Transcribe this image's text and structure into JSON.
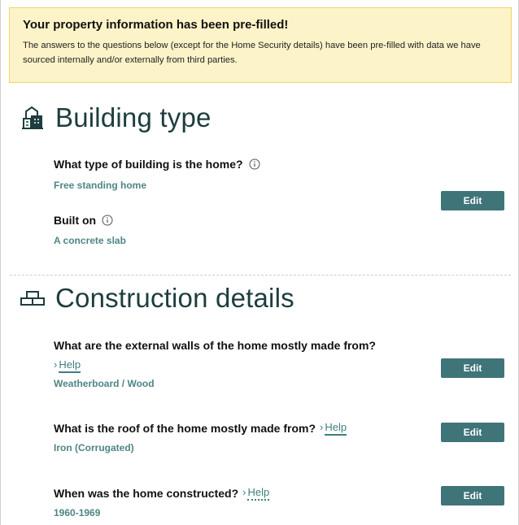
{
  "banner": {
    "title": "Your property information has been pre-filled!",
    "text": "The answers to the questions below (except for the Home Security details) have been pre-filled with data we have sourced internally and/or externally from third parties."
  },
  "building_type": {
    "title": "Building type",
    "icon": "building-icon",
    "questions": [
      {
        "label": "What type of building is the home?",
        "answer": "Free standing home",
        "has_info": true
      },
      {
        "label": "Built on",
        "answer": "A concrete slab",
        "has_info": true
      }
    ],
    "edit_label": "Edit"
  },
  "construction": {
    "title": "Construction details",
    "icon": "bricks-icon",
    "questions": [
      {
        "label": "What are the external walls of the home mostly made from?",
        "help": "Help",
        "answer": "Weatherboard / Wood",
        "edit_label": "Edit"
      },
      {
        "label": "What is the roof of the home mostly made from?",
        "help": "Help",
        "answer": "Iron (Corrugated)",
        "edit_label": "Edit"
      },
      {
        "label": "When was the home constructed?",
        "help": "Help",
        "answer": "1960-1969",
        "edit_label": "Edit"
      }
    ]
  },
  "colors": {
    "accent": "#3f7478",
    "answer": "#4f8584",
    "banner_bg": "#fdf3c8",
    "banner_border": "#f0d46a",
    "heading": "#1e3d3f"
  }
}
